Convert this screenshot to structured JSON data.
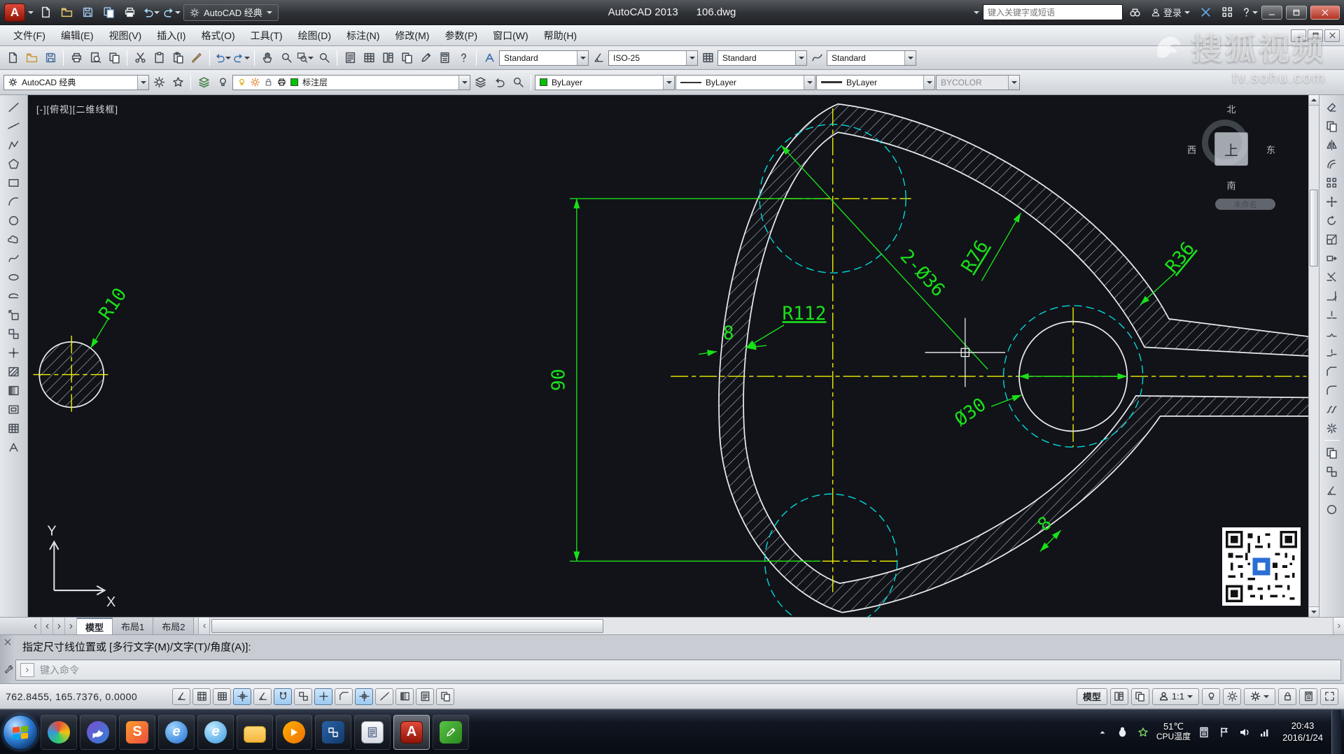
{
  "title_bar": {
    "workspace": "AutoCAD 经典",
    "app_title": "AutoCAD 2013",
    "doc_name": "106.dwg",
    "search_placeholder": "键入关键字或短语",
    "signin": "登录"
  },
  "watermark": {
    "brand": "搜狐视频",
    "url": "tv.sohu.com"
  },
  "menu": [
    "文件(F)",
    "编辑(E)",
    "视图(V)",
    "插入(I)",
    "格式(O)",
    "工具(T)",
    "绘图(D)",
    "标注(N)",
    "修改(M)",
    "参数(P)",
    "窗口(W)",
    "帮助(H)"
  ],
  "style_bar": {
    "text_style": "Standard",
    "dim_style": "ISO-25",
    "table_style": "Standard",
    "mleader_style": "Standard"
  },
  "layer_bar": {
    "workspace": "AutoCAD 经典",
    "layer": "标注层",
    "color": "ByLayer",
    "linetype": "ByLayer",
    "lineweight": "ByLayer",
    "plot_style": "BYCOLOR"
  },
  "viewport": {
    "view_label": "[-][俯视][二维线框]",
    "view_tag": "未命名",
    "compass": {
      "n": "北",
      "s": "南",
      "w": "西",
      "e": "东",
      "center": "上"
    },
    "ucs": {
      "x": "X",
      "y": "Y"
    }
  },
  "dims": {
    "r10": "R10",
    "height": "90",
    "r112": "R112",
    "rim_top": "8",
    "holes": "2-Ø36",
    "r76": "R76",
    "r36": "R36",
    "bore": "Ø30",
    "rim_bottom": "8"
  },
  "tabs": [
    "模型",
    "布局1",
    "布局2"
  ],
  "command": {
    "history": "指定尺寸线位置或 [多行文字(M)/文字(T)/角度(A)]:",
    "placeholder": "键入命令"
  },
  "status": {
    "coords": "762.8455, 165.7376, 0.0000",
    "model": "模型",
    "scale": "1:1"
  },
  "taskbar": {
    "temp": "51℃",
    "temp_label": "CPU温度",
    "time": "20:43",
    "date": "2016/1/24",
    "glyphs": {
      "ie": "e",
      "ie2": "e",
      "sogou": "S",
      "autocad": "A"
    }
  },
  "icons": {
    "quick_access": [
      "new",
      "open",
      "save",
      "plot",
      "undo",
      "redo"
    ],
    "draw": [
      "line",
      "construction-line",
      "polyline",
      "polygon",
      "rectangle",
      "arc",
      "circle",
      "revision-cloud",
      "spline",
      "ellipse",
      "ellipse-arc",
      "insert-block",
      "create-block",
      "point",
      "hatch",
      "gradient",
      "region",
      "table",
      "multiline-text"
    ],
    "modify": [
      "erase",
      "copy",
      "mirror",
      "offset",
      "array",
      "move",
      "rotate",
      "scale",
      "stretch",
      "trim",
      "extend",
      "break-at-point",
      "break",
      "join",
      "chamfer",
      "fillet",
      "blend",
      "explode"
    ]
  }
}
